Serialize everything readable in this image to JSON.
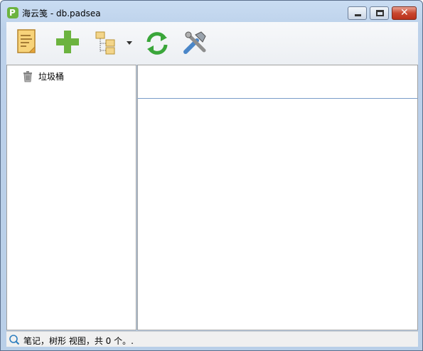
{
  "window": {
    "title": "海云笺 - db.padsea",
    "app_icon_glyph": "P",
    "close_glyph": "✕"
  },
  "toolbar": {
    "buttons": [
      {
        "name": "new-note",
        "icon": "note-icon"
      },
      {
        "name": "add",
        "icon": "plus-icon"
      },
      {
        "name": "tree-view",
        "icon": "folder-tree-icon"
      },
      {
        "name": "sync",
        "icon": "sync-icon"
      },
      {
        "name": "tools",
        "icon": "tools-icon"
      }
    ]
  },
  "tree": {
    "items": [
      {
        "label": "垃圾桶",
        "icon": "trash-icon"
      }
    ]
  },
  "status": {
    "text": "笔记，树形 视图，共 0 个。."
  },
  "colors": {
    "title_gradient_top": "#c9dcf2",
    "close_button": "#c9472f",
    "add_green": "#6cb33f",
    "sync_green": "#3aa63a"
  }
}
